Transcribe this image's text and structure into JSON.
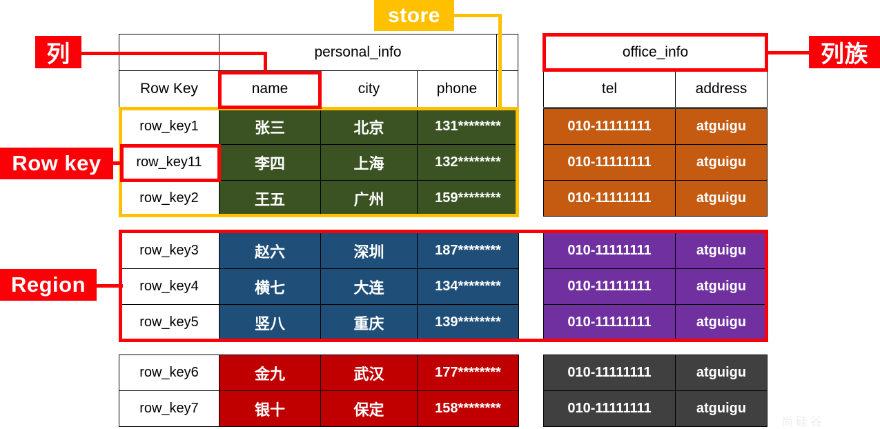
{
  "annotations": {
    "column": "列",
    "column_family": "列族",
    "row_key": "Row key",
    "region": "Region",
    "store": "store"
  },
  "personal_table": {
    "family_label": "personal_info",
    "corner_label": "",
    "headers": [
      "Row Key",
      "name",
      "city",
      "phone"
    ],
    "rows": [
      {
        "row_key": "row_key1",
        "name": "张三",
        "city": "北京",
        "phone": "131********"
      },
      {
        "row_key": "row_key11",
        "name": "李四",
        "city": "上海",
        "phone": "132********"
      },
      {
        "row_key": "row_key2",
        "name": "王五",
        "city": "广州",
        "phone": "159********"
      },
      {
        "row_key": "row_key3",
        "name": "赵六",
        "city": "深圳",
        "phone": "187********"
      },
      {
        "row_key": "row_key4",
        "name": "横七",
        "city": "大连",
        "phone": "134********"
      },
      {
        "row_key": "row_key5",
        "name": "竖八",
        "city": "重庆",
        "phone": "139********"
      },
      {
        "row_key": "row_key6",
        "name": "金九",
        "city": "武汉",
        "phone": "177********"
      },
      {
        "row_key": "row_key7",
        "name": "银十",
        "city": "保定",
        "phone": "158********"
      }
    ]
  },
  "office_table": {
    "family_label": "office_info",
    "headers": [
      "tel",
      "address"
    ],
    "rows": [
      {
        "tel": "010-11111111",
        "address": "atguigu"
      },
      {
        "tel": "010-11111111",
        "address": "atguigu"
      },
      {
        "tel": "010-11111111",
        "address": "atguigu"
      },
      {
        "tel": "010-11111111",
        "address": "atguigu"
      },
      {
        "tel": "010-11111111",
        "address": "atguigu"
      },
      {
        "tel": "010-11111111",
        "address": "atguigu"
      },
      {
        "tel": "010-11111111",
        "address": "atguigu"
      },
      {
        "tel": "010-11111111",
        "address": "atguigu"
      }
    ]
  },
  "region_fill_colors": {
    "region1_personal": "#3b5323",
    "region1_office": "#c55a11",
    "region2_personal": "#1f4e79",
    "region2_office": "#7030a0",
    "region3_personal": "#c00000",
    "region3_office": "#404040",
    "highlight_red": "#fb0007",
    "highlight_yellow": "#ffc000"
  },
  "watermark": "尚硅谷"
}
